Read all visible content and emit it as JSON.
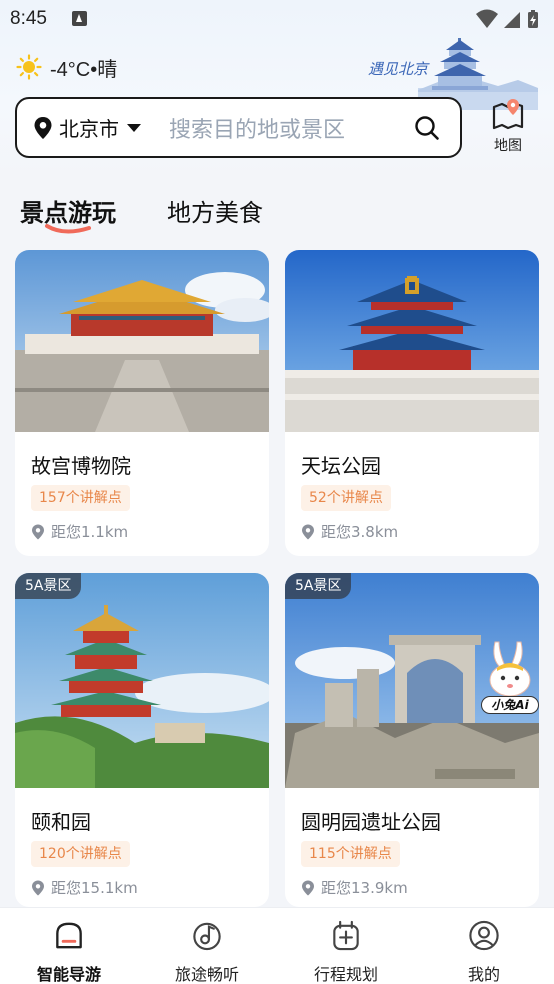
{
  "status_bar": {
    "time": "8:45"
  },
  "header": {
    "weather": "-4°C•晴",
    "decoration_text": "遇见北京"
  },
  "search": {
    "city": "北京市",
    "placeholder": "搜索目的地或景区"
  },
  "map_button": {
    "label": "地图"
  },
  "tabs": [
    {
      "label": "景点游玩",
      "active": true
    },
    {
      "label": "地方美食",
      "active": false
    }
  ],
  "attractions": [
    {
      "name": "故宫博物院",
      "guide_points": "157个讲解点",
      "distance": "距您1.1km",
      "tag": ""
    },
    {
      "name": "天坛公园",
      "guide_points": "52个讲解点",
      "distance": "距您3.8km",
      "tag": ""
    },
    {
      "name": "颐和园",
      "guide_points": "120个讲解点",
      "distance": "距您15.1km",
      "tag": "5A景区"
    },
    {
      "name": "圆明园遗址公园",
      "guide_points": "115个讲解点",
      "distance": "距您13.9km",
      "tag": "5A景区"
    }
  ],
  "mascot": {
    "label": "小兔Ai"
  },
  "bottom_nav": [
    {
      "label": "智能导游",
      "active": true,
      "icon": "guide-icon"
    },
    {
      "label": "旅途畅听",
      "active": false,
      "icon": "music-icon"
    },
    {
      "label": "行程规划",
      "active": false,
      "icon": "calendar-plus-icon"
    },
    {
      "label": "我的",
      "active": false,
      "icon": "profile-icon"
    }
  ],
  "colors": {
    "accent_orange": "#e8874a",
    "badge_bg": "#fdf1e7",
    "underline_red": "#f06a5a",
    "decoration_blue": "#3a66b7"
  }
}
